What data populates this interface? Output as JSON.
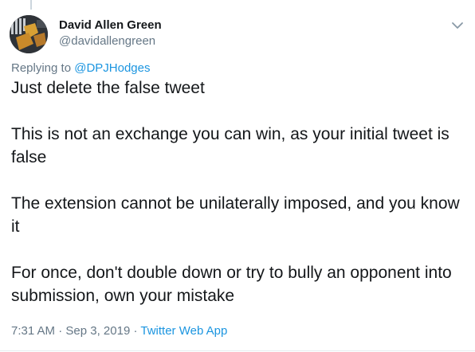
{
  "tweet": {
    "author_name": "David Allen Green",
    "author_handle": "@davidallengreen",
    "replying_to_prefix": "Replying to",
    "replying_to_mention": "@DPJHodges",
    "paragraphs": [
      "Just delete the false tweet",
      "This is not an exchange you can win, as your initial tweet is false",
      "The extension cannot be unilaterally imposed, and you know it",
      "For once, don't double down or try to bully an opponent into submission, own your mistake"
    ],
    "time": "7:31 AM",
    "separator": "·",
    "date": "Sep 3, 2019",
    "source": "Twitter Web App"
  },
  "icons": {
    "menu": "chevron-down-icon",
    "avatar": "avatar-photo"
  },
  "colors": {
    "link": "#1b95e0",
    "secondary": "#657786",
    "text": "#14171a"
  }
}
